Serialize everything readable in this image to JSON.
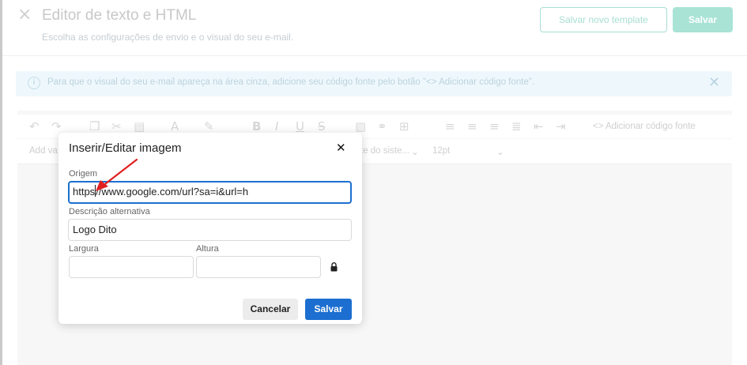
{
  "page": {
    "title": "Editor de texto e HTML",
    "subtitle": "Escolha as configurações de envio e o visual do seu e-mail.",
    "save_template_label": "Salvar novo template",
    "save_label": "Salvar"
  },
  "info_banner": {
    "text": "Para que o visual do seu e-mail apareça na área cinza, adicione seu código fonte pelo botão \"<> Adicionar código fonte\"."
  },
  "toolbar": {
    "add_source_label": "<> Adicionar código fonte",
    "add_var_label": "Add va",
    "font_family_label": "te do siste...",
    "font_size_label": "12pt"
  },
  "dialog": {
    "title": "Inserir/Editar imagem",
    "origin_label": "Origem",
    "origin_value_before_caret": "https",
    "origin_value_after_caret": "//www.google.com/url?sa=i&url=h",
    "alt_label": "Descrição alternativa",
    "alt_value": "Logo Dito",
    "width_label": "Largura",
    "width_value": "",
    "height_label": "Altura",
    "height_value": "",
    "cancel_label": "Cancelar",
    "save_label": "Salvar"
  },
  "colors": {
    "primary": "#1c6fd0",
    "accent_teal": "#a9e3d6",
    "annotation_arrow": "#e02020"
  }
}
